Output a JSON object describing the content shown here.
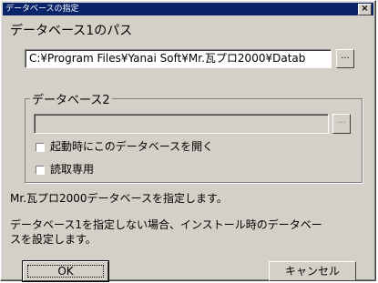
{
  "window": {
    "title": "データベースの指定",
    "close_label": "×"
  },
  "db1": {
    "label": "データベース1のパス",
    "path_value": "C:¥Program Files¥Yanai Soft¥Mr.瓦プロ2000¥Datab",
    "browse_label": "..."
  },
  "db2": {
    "group_label": "データベース2",
    "path_value": "",
    "browse_label": "...",
    "open_on_start_label": "起動時にこのデータベースを開く",
    "read_only_label": "読取専用"
  },
  "info": {
    "line1": "Mr.瓦プロ2000データベースを指定します。",
    "line2a": "データベース1を指定しない場合、インストール時のデータベー",
    "line2b": "スを設定します。"
  },
  "buttons": {
    "ok": "OK",
    "cancel": "キャンセル"
  }
}
